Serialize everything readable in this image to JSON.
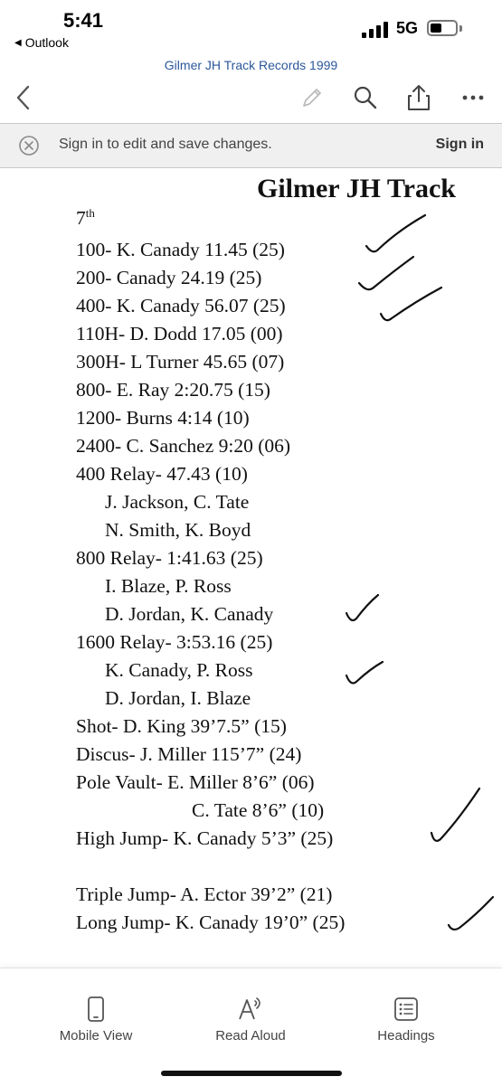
{
  "status": {
    "time": "5:41",
    "back_app": "Outlook",
    "network": "5G"
  },
  "doc_title": "Gilmer JH Track Records 1999",
  "toolbar": {
    "icons": [
      "back-chevron-icon",
      "pen-icon",
      "search-icon",
      "share-icon",
      "more-icon"
    ]
  },
  "infobar": {
    "message": "Sign in to edit and save changes.",
    "sign_in": "Sign in"
  },
  "document": {
    "heading": "Gilmer JH Track",
    "grade": "7",
    "grade_suffix": "th",
    "lines": [
      "100- K. Canady 11.45 (25)",
      "200- Canady 24.19 (25)",
      "400- K. Canady 56.07 (25)",
      "110H- D. Dodd 17.05 (00)",
      "300H- L Turner 45.65 (07)",
      "800- E. Ray 2:20.75 (15)",
      "1200- Burns 4:14 (10)",
      "2400- C. Sanchez 9:20 (06)",
      "400 Relay- 47.43 (10)",
      "J. Jackson, C. Tate",
      "N. Smith, K. Boyd",
      "800 Relay- 1:41.63 (25)",
      "I. Blaze, P. Ross",
      "D. Jordan, K. Canady",
      "1600 Relay- 3:53.16 (25)",
      "K. Canady, P. Ross",
      "D. Jordan, I. Blaze",
      "Shot- D. King 39’7.5” (15)",
      "Discus- J. Miller 115’7” (24)",
      "Pole Vault- E. Miller 8’6” (06)",
      "C. Tate 8’6” (10)",
      "High Jump- K. Canady 5’3” (25)",
      "Triple Jump- A. Ector 39’2” (21)",
      "Long Jump- K. Canady 19’0” (25)"
    ]
  },
  "bottombar": {
    "mobile_view": "Mobile View",
    "read_aloud": "Read Aloud",
    "headings": "Headings"
  }
}
